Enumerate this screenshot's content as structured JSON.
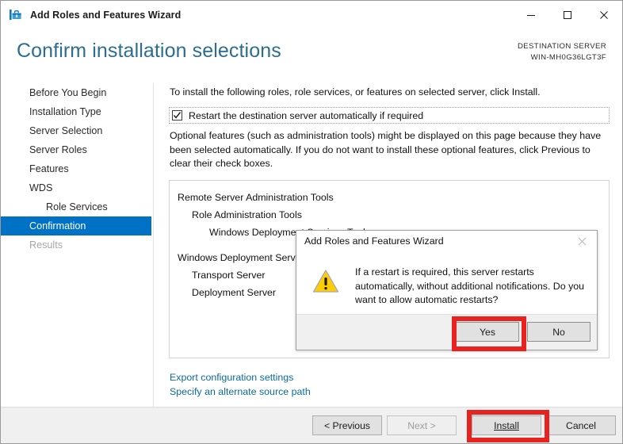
{
  "window": {
    "title": "Add Roles and Features Wizard",
    "app_icon": "toolbox-icon",
    "minimize_label": "–",
    "maximize_label": "□",
    "close_label": "✕"
  },
  "header": {
    "page_title": "Confirm installation selections",
    "destination_label": "DESTINATION SERVER",
    "destination_server": "WIN-MH0G36LGT3F"
  },
  "sidebar": {
    "items": [
      {
        "label": "Before You Begin",
        "state": "normal",
        "indent": false
      },
      {
        "label": "Installation Type",
        "state": "normal",
        "indent": false
      },
      {
        "label": "Server Selection",
        "state": "normal",
        "indent": false
      },
      {
        "label": "Server Roles",
        "state": "normal",
        "indent": false
      },
      {
        "label": "Features",
        "state": "normal",
        "indent": false
      },
      {
        "label": "WDS",
        "state": "normal",
        "indent": false
      },
      {
        "label": "Role Services",
        "state": "normal",
        "indent": true
      },
      {
        "label": "Confirmation",
        "state": "active",
        "indent": false
      },
      {
        "label": "Results",
        "state": "disabled",
        "indent": false
      }
    ]
  },
  "main": {
    "intro_text": "To install the following roles, role services, or features on selected server, click Install.",
    "restart_checkbox": {
      "label": "Restart the destination server automatically if required",
      "checked": true
    },
    "optional_text": "Optional features (such as administration tools) might be displayed on this page because they have been selected automatically. If you do not want to install these optional features, click Previous to clear their check boxes.",
    "feature_list": [
      {
        "label": "Remote Server Administration Tools",
        "level": 0
      },
      {
        "label": "Role Administration Tools",
        "level": 1
      },
      {
        "label": "Windows Deployment Services Tools",
        "level": 2
      },
      {
        "label": "",
        "level": -1
      },
      {
        "label": "Windows Deployment Services",
        "level": 0
      },
      {
        "label": "Transport Server",
        "level": 1
      },
      {
        "label": "Deployment Server",
        "level": 1
      }
    ],
    "links": [
      {
        "label": "Export configuration settings"
      },
      {
        "label": "Specify an alternate source path"
      }
    ]
  },
  "footer": {
    "previous": {
      "label": "< Previous",
      "mnemonic": "P",
      "disabled": false
    },
    "next": {
      "label": "Next >",
      "mnemonic": "N",
      "disabled": true
    },
    "install": {
      "label": "Install",
      "mnemonic": "I",
      "disabled": false
    },
    "cancel": {
      "label": "Cancel",
      "disabled": false
    }
  },
  "dialog": {
    "title": "Add Roles and Features Wizard",
    "close_label": "✕",
    "icon": "warning-triangle-icon",
    "message": "If a restart is required, this server restarts automatically, without additional notifications. Do you want to allow automatic restarts?",
    "yes_label": "Yes",
    "no_label": "No"
  },
  "annotations": {
    "highlight_color": "#e8231f",
    "boxes": [
      {
        "target": "yes-button"
      },
      {
        "target": "install-button"
      }
    ]
  }
}
